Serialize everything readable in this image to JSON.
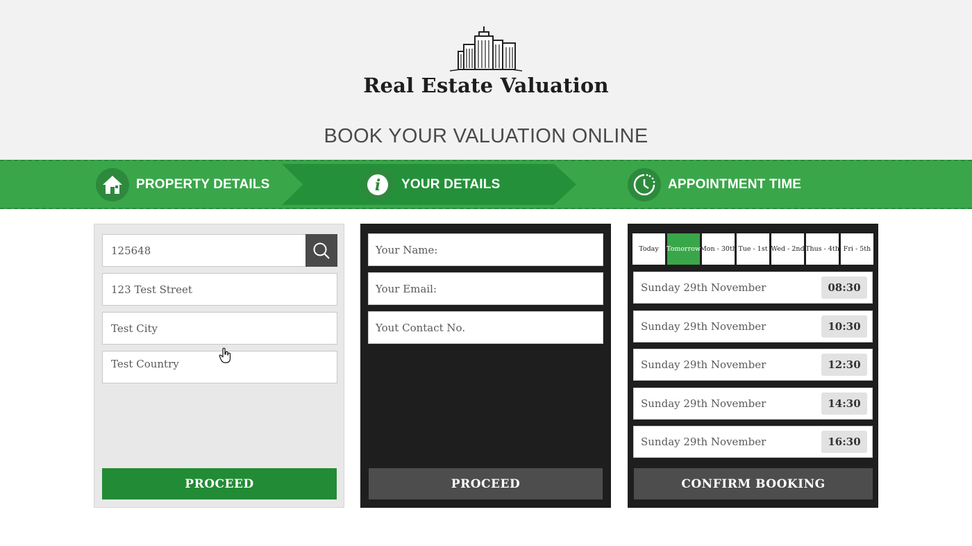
{
  "header": {
    "brand": "Real Estate Valuation",
    "subtitle": "BOOK YOUR VALUATION ONLINE",
    "logo_icon": "building-icon"
  },
  "steps": [
    {
      "label": "PROPERTY DETAILS",
      "icon": "house-icon"
    },
    {
      "label": "YOUR DETAILS",
      "icon": "info-icon"
    },
    {
      "label": "APPOINTMENT TIME",
      "icon": "clock-icon"
    }
  ],
  "property": {
    "postcode": "125648",
    "street": "123 Test Street",
    "city": "Test City",
    "country": "Test Country",
    "proceed": "PROCEED"
  },
  "details": {
    "name_placeholder": "Your Name:",
    "email_placeholder": "Your Email:",
    "contact_placeholder": "Yout Contact No.",
    "proceed": "PROCEED"
  },
  "appointment": {
    "days": [
      "Today",
      "Tomorrow",
      "Mon - 30th",
      "Tue - 1st",
      "Wed - 2nd",
      "Thus - 4th",
      "Fri - 5th"
    ],
    "selected_day": "Tomorrow",
    "slots": [
      {
        "date": "Sunday 29th November",
        "time": "08:30"
      },
      {
        "date": "Sunday 29th November",
        "time": "10:30"
      },
      {
        "date": "Sunday 29th November",
        "time": "12:30"
      },
      {
        "date": "Sunday 29th November",
        "time": "14:30"
      },
      {
        "date": "Sunday 29th November",
        "time": "16:30"
      }
    ],
    "confirm": "CONFIRM BOOKING"
  },
  "colors": {
    "accent_green": "#3aa64a",
    "dark_green": "#228b35",
    "panel_dark": "#1e1e1e"
  }
}
